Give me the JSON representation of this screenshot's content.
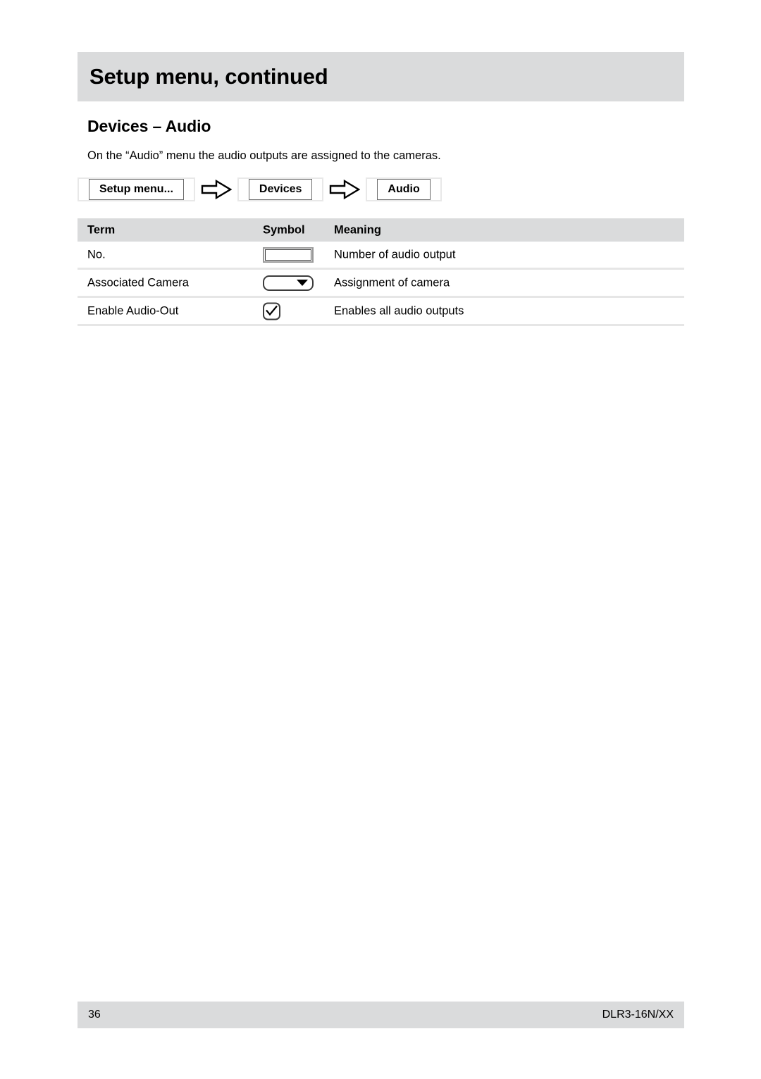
{
  "running_head": {
    "title": "Setup menu, continued"
  },
  "section": {
    "title": "Devices – Audio",
    "intro": "On the “Audio” menu the audio outputs are assigned to the cameras."
  },
  "breadcrumb": {
    "items": [
      {
        "label": "Setup menu..."
      },
      {
        "label": "Devices"
      },
      {
        "label": "Audio"
      }
    ],
    "separator_icon": "right-block-arrow-icon"
  },
  "table": {
    "headers": {
      "term": "Term",
      "symbol": "Symbol",
      "meaning": "Meaning"
    },
    "rows": [
      {
        "term": "No.",
        "symbol_icon": "textbox-icon",
        "meaning": "Number of audio output"
      },
      {
        "term": "Associated Camera",
        "symbol_icon": "dropdown-icon",
        "meaning": "Assignment of camera"
      },
      {
        "term": "Enable Audio-Out",
        "symbol_icon": "checkbox-checked-icon",
        "meaning": "Enables all audio outputs"
      }
    ]
  },
  "footer": {
    "page_number": "36",
    "model": "DLR3-16N/XX"
  },
  "colors": {
    "band_gray": "#dadbdc",
    "rule_gray": "#e6e6e6",
    "text": "#000000",
    "widget_outline": "#3c3c3c"
  }
}
